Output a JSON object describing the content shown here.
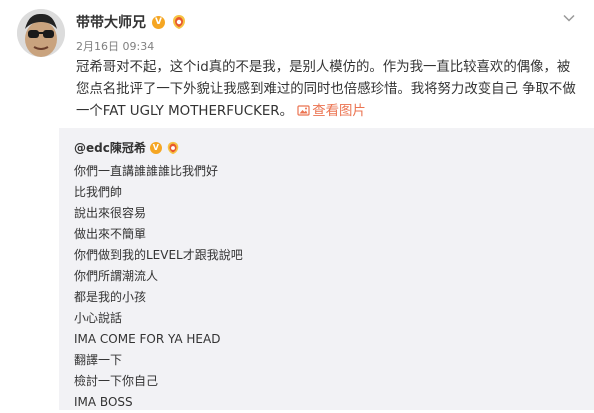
{
  "post": {
    "author": "带带大师兄",
    "verified_badge": "V",
    "level_badge_icon": "weibo-level-badge-icon",
    "timestamp": "2月16日 09:34",
    "text": "冠希哥对不起，这个id真的不是我，是别人模仿的。作为我一直比较喜欢的偶像，被您点名批评了一下外貌让我感到难过的同时也倍感珍惜。我将努力改变自己 争取不做一个FAT UGLY MOTHERFUCKER。",
    "view_image_label": "查看图片",
    "menu_icon": "chevron-down-icon"
  },
  "repost": {
    "author": "@edc陳冠希",
    "verified_badge": "V",
    "lines": [
      "你們一直講誰誰誰比我們好",
      "比我們帥",
      "說出來很容易",
      "做出來不簡單",
      "你們做到我的LEVEL才跟我說吧",
      "你們所謂潮流人",
      "都是我的小孩",
      "小心說話",
      "IMA COME FOR YA HEAD",
      "翻譯一下",
      "檢討一下你自己",
      "IMA BOSS"
    ]
  },
  "colors": {
    "link": "#eb7350",
    "verified": "#f5a623",
    "repost_bg": "#f2f2f5",
    "meta": "#808080"
  }
}
